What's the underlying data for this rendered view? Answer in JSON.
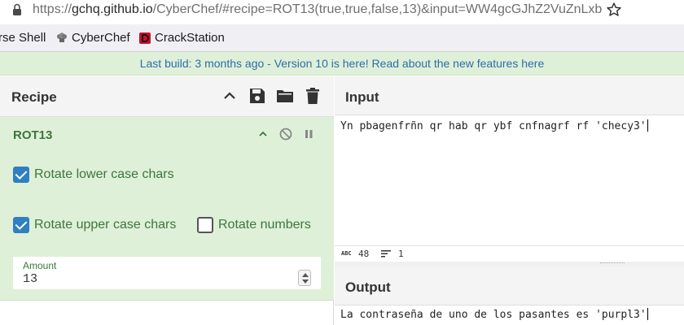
{
  "browser": {
    "url_prefix": "https://",
    "url_domain": "gchq.github.io",
    "url_path": "/CyberChef/#recipe=ROT13(true,true,false,13)&input=WW4gcGJhZ2VuZnLxbiBx",
    "icons": [
      "lock-icon",
      "star-icon"
    ]
  },
  "bookmarks": [
    {
      "label": "rse Shell",
      "icon": ""
    },
    {
      "label": "CyberChef",
      "icon": "chef-hat-icon"
    },
    {
      "label": "CrackStation",
      "icon": "crackstation-icon"
    }
  ],
  "banner": {
    "text": "Last build: 3 months ago - Version 10 is here! Read about the new features ",
    "link": "here"
  },
  "recipe": {
    "title": "Recipe",
    "operation": {
      "name": "ROT13",
      "options": {
        "rotate_lower": {
          "label": "Rotate lower case chars",
          "checked": true
        },
        "rotate_upper": {
          "label": "Rotate upper case chars",
          "checked": true
        },
        "rotate_numbers": {
          "label": "Rotate numbers",
          "checked": false
        }
      },
      "amount": {
        "label": "Amount",
        "value": "13"
      }
    }
  },
  "input": {
    "title": "Input",
    "text": "Yn pbagenfrñn qr hab qr ybf cnfnagrf rf 'checy3'",
    "length": "48",
    "lines": "1",
    "abc_label": "ABC"
  },
  "output": {
    "title": "Output",
    "text": "La contraseña de uno de los pasantes es 'purpl3'"
  },
  "colors": {
    "accent_blue": "#2f7fc1",
    "operation_bg": "#dff0d8",
    "operation_text": "#3c763d",
    "banner_link": "#2f6cad"
  }
}
